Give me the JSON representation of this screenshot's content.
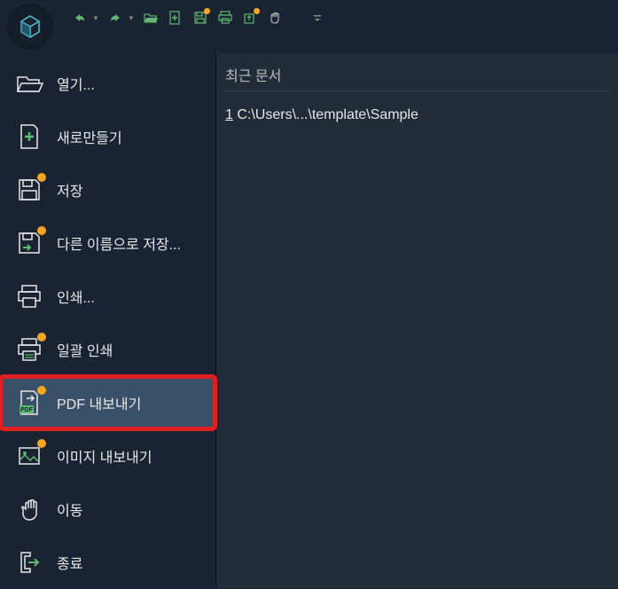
{
  "toolbar": {
    "icons": [
      "undo",
      "redo",
      "open",
      "new",
      "save",
      "print",
      "publish",
      "pan",
      "more"
    ]
  },
  "menu": {
    "items": [
      {
        "id": "open",
        "label": "열기...",
        "icon": "folder-open",
        "badge": false
      },
      {
        "id": "new",
        "label": "새로만들기",
        "icon": "file-new",
        "badge": false
      },
      {
        "id": "save",
        "label": "저장",
        "icon": "save",
        "badge": true
      },
      {
        "id": "saveas",
        "label": "다른 이름으로 저장...",
        "icon": "save-as",
        "badge": true
      },
      {
        "id": "print",
        "label": "인쇄...",
        "icon": "print",
        "badge": false
      },
      {
        "id": "batchprint",
        "label": "일괄 인쇄",
        "icon": "batch-print",
        "badge": true
      },
      {
        "id": "pdfexport",
        "label": "PDF 내보내기",
        "icon": "pdf-export",
        "badge": true,
        "highlighted": true
      },
      {
        "id": "imgexport",
        "label": "이미지 내보내기",
        "icon": "image-export",
        "badge": true
      },
      {
        "id": "move",
        "label": "이동",
        "icon": "hand",
        "badge": false
      },
      {
        "id": "exit",
        "label": "종료",
        "icon": "exit",
        "badge": false
      }
    ]
  },
  "recent": {
    "header": "최근 문서",
    "items": [
      {
        "num": "1",
        "path": "C:\\Users\\...\\template\\Sample"
      }
    ]
  }
}
